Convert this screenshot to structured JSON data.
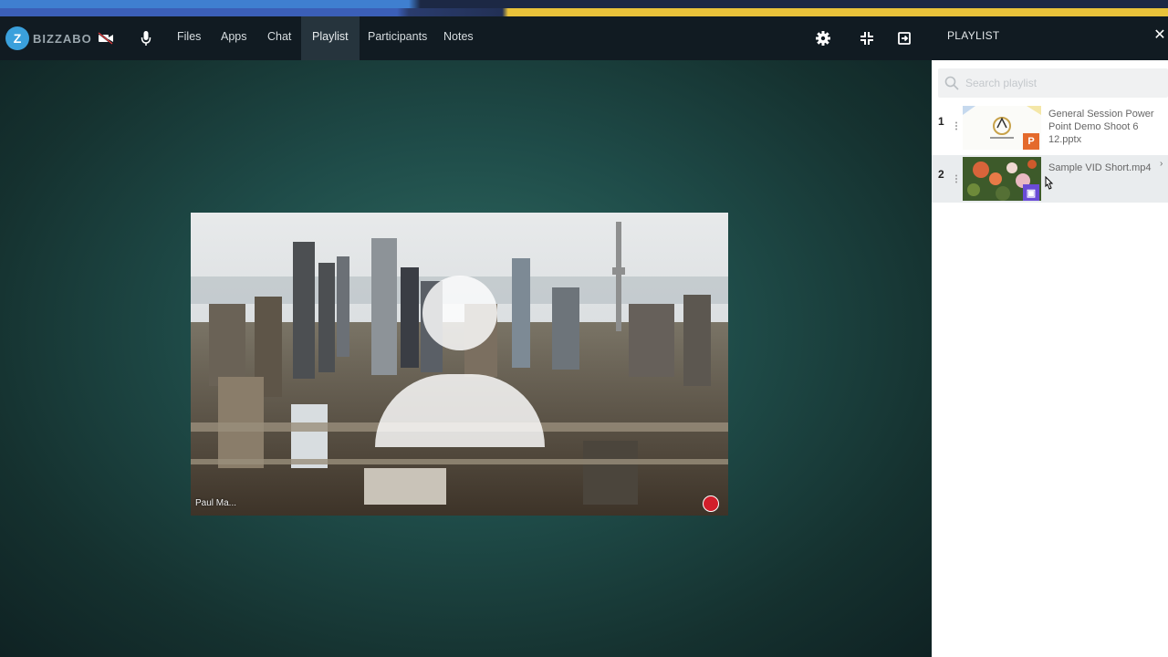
{
  "app": {
    "name": "BIZZABO",
    "logo_letter": "Z"
  },
  "nav": {
    "items": [
      {
        "label": "Files"
      },
      {
        "label": "Apps"
      },
      {
        "label": "Chat"
      },
      {
        "label": "Playlist",
        "active": true
      },
      {
        "label": "Participants"
      },
      {
        "label": "Notes"
      }
    ]
  },
  "panel": {
    "title": "PLAYLIST",
    "close_icon": "close-icon"
  },
  "search": {
    "placeholder": "Search playlist"
  },
  "playlist": [
    {
      "index": "1",
      "title": "General Session Power Point Demo Shoot 6 12.pptx",
      "type_label": "P",
      "type_color": "#e46a2c"
    },
    {
      "index": "2",
      "title": "Sample VID Short.mp4",
      "type_label": "▣",
      "type_color": "#6a4bd6"
    }
  ],
  "tile": {
    "participant_name": "Paul Ma..."
  },
  "colors": {
    "accent_blue": "#3aa0dc",
    "nav_bg": "#111b22",
    "stage_teal": "#2f6a61"
  }
}
